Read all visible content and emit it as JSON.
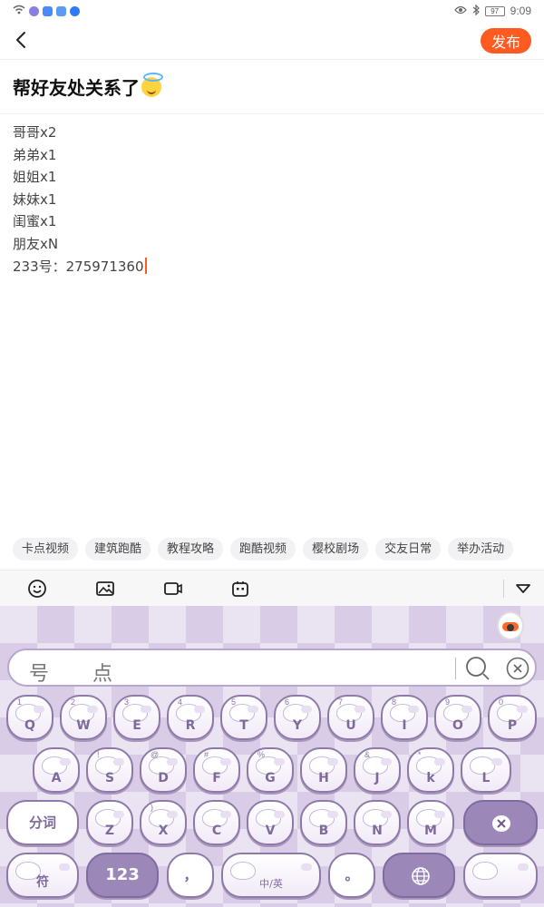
{
  "status_bar": {
    "time": "9:09",
    "battery": "97"
  },
  "header": {
    "publish_label": "发布"
  },
  "post": {
    "title": "帮好友处关系了",
    "lines": [
      "哥哥x2",
      "弟弟x1",
      "姐姐x1",
      "妹妹x1",
      "闺蜜x1",
      "朋友xN",
      "233号：275971360"
    ]
  },
  "tags": [
    "卡点视频",
    "建筑跑酷",
    "教程攻略",
    "跑酷视频",
    "樱校剧场",
    "交友日常",
    "举办活动"
  ],
  "toolbar": {
    "icons": [
      "emoji-icon",
      "image-icon",
      "video-icon",
      "game-icon",
      "collapse-icon"
    ]
  },
  "keyboard": {
    "candidates": [
      "号",
      "点"
    ],
    "row1": [
      "Q",
      "W",
      "E",
      "R",
      "T",
      "Y",
      "U",
      "I",
      "O",
      "P"
    ],
    "row1_sub": [
      "1",
      "2",
      "3",
      "4",
      "5",
      "6",
      "7",
      "8",
      "9",
      "0"
    ],
    "row2": [
      "A",
      "S",
      "D",
      "F",
      "G",
      "H",
      "J",
      "k",
      "L"
    ],
    "row2_sub": [
      "",
      "!",
      "@",
      "#",
      "%",
      "",
      "&",
      "*",
      ""
    ],
    "row3": [
      "Z",
      "X",
      "C",
      "V",
      "B",
      "N",
      "M"
    ],
    "row3_sub": [
      "",
      ")",
      "",
      "",
      "",
      "",
      ""
    ],
    "fenci_label": "分词",
    "symbol_label": "符",
    "numbers_label": "123",
    "comma_label": "，",
    "space_label": "中/英",
    "period_label": "。",
    "colors": {
      "accent": "#ff5a1f",
      "key_border": "#8e7aa8",
      "dark_key": "#9b88b9"
    }
  }
}
